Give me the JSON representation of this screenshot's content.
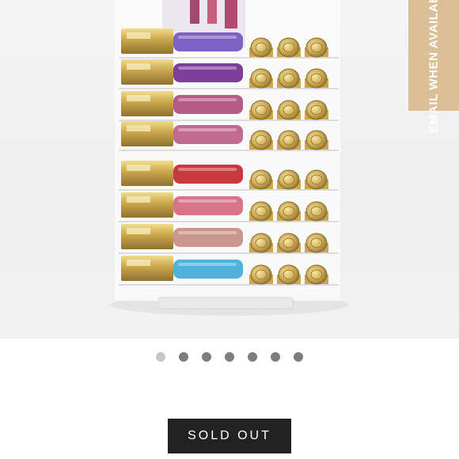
{
  "product": {
    "image_alt": "acrylic makeup organizer tower with lip glosses and lipsticks"
  },
  "email_tab": {
    "label": "EMAIL WHEN AVAILABLE"
  },
  "carousel": {
    "slide_count": 7,
    "active_index": 0
  },
  "buy_button": {
    "label": "SOLD OUT"
  },
  "gloss_colors": [
    "#7c62c4",
    "#7e3f9a",
    "#b65a86",
    "#c26a90",
    "#c8383e",
    "#d8748a",
    "#c9978f",
    "#4fb2dd"
  ],
  "accent_color": "#dcbf96"
}
